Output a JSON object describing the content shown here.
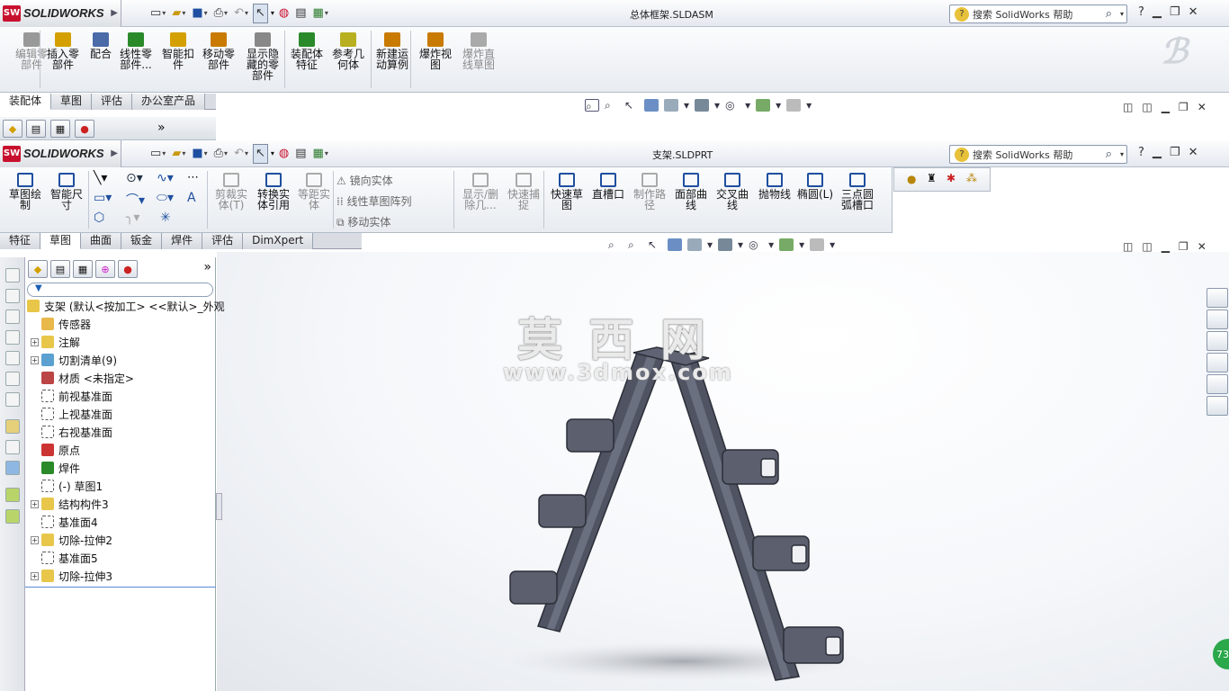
{
  "app": {
    "brand": "SOLIDWORKS",
    "logo_mark": "SW"
  },
  "assembly_window": {
    "title": "总体框架.SLDASM",
    "search_placeholder": "搜索 SolidWorks 帮助",
    "help_label": "?",
    "ribbon_buttons": [
      {
        "label": "编辑零\n部件",
        "icon": "edit-component-icon",
        "disabled": true
      },
      {
        "label": "插入零\n部件",
        "icon": "insert-component-icon"
      },
      {
        "label": "配合",
        "icon": "mate-icon"
      },
      {
        "label": "线性零\n部件...",
        "icon": "linear-pattern-icon"
      },
      {
        "label": "智能扣\n件",
        "icon": "smart-fastener-icon"
      },
      {
        "label": "移动零\n部件",
        "icon": "move-component-icon"
      },
      {
        "label": "显示隐\n藏的零\n部件",
        "icon": "show-hidden-icon"
      },
      {
        "label": "装配体\n特征",
        "icon": "assembly-feature-icon"
      },
      {
        "label": "参考几\n何体",
        "icon": "reference-geometry-icon"
      },
      {
        "label": "新建运\n动算例",
        "icon": "motion-study-icon"
      },
      {
        "label": "爆炸视\n图",
        "icon": "exploded-view-icon"
      },
      {
        "label": "爆炸直\n线草图",
        "icon": "explode-line-icon",
        "disabled": true
      }
    ],
    "tabs": [
      "装配体",
      "草图",
      "评估",
      "办公室产品"
    ],
    "active_tab": 0,
    "more_label": "»"
  },
  "part_window": {
    "title": "支架.SLDPRT",
    "search_placeholder": "搜索 SolidWorks 帮助",
    "help_label": "?",
    "ribbon_buttons": [
      {
        "label": "草图绘\n制",
        "icon": "sketch-icon"
      },
      {
        "label": "智能尺\n寸",
        "icon": "smart-dimension-icon"
      },
      {
        "label": "剪裁实\n体(T)",
        "icon": "trim-icon",
        "disabled": true
      },
      {
        "label": "转换实\n体引用",
        "icon": "convert-entities-icon"
      },
      {
        "label": "等距实\n体",
        "icon": "offset-entities-icon",
        "disabled": true
      },
      {
        "label": "显示/删\n除几...",
        "icon": "display-relations-icon",
        "disabled": true
      },
      {
        "label": "快速捕\n捉",
        "icon": "quick-snaps-icon",
        "disabled": true
      },
      {
        "label": "快速草\n图",
        "icon": "rapid-sketch-icon"
      },
      {
        "label": "直槽口",
        "icon": "straight-slot-icon"
      },
      {
        "label": "制作路\n径",
        "icon": "make-path-icon",
        "disabled": true
      },
      {
        "label": "面部曲\n线",
        "icon": "face-curves-icon"
      },
      {
        "label": "交叉曲\n线",
        "icon": "intersection-curve-icon"
      },
      {
        "label": "抛物线",
        "icon": "parabola-icon"
      },
      {
        "label": "椭圆(L)",
        "icon": "ellipse-icon"
      },
      {
        "label": "三点圆\n弧槽口",
        "icon": "arc-slot-icon"
      }
    ],
    "small_items": [
      "镜向实体",
      "线性草图阵列",
      "移动实体"
    ],
    "tabs": [
      "特征",
      "草图",
      "曲面",
      "钣金",
      "焊件",
      "评估",
      "DimXpert"
    ],
    "active_tab": 1
  },
  "feature_tree": {
    "root": "支架  (默认<按加工> <<默认>_外观",
    "items": [
      {
        "label": "传感器",
        "expandable": false,
        "icon": "sensor-icon"
      },
      {
        "label": "注解",
        "expandable": true,
        "icon": "annotation-icon"
      },
      {
        "label": "切割清单(9)",
        "expandable": true,
        "icon": "cut-list-icon"
      },
      {
        "label": "材质 <未指定>",
        "expandable": false,
        "icon": "material-icon"
      },
      {
        "label": "前视基准面",
        "expandable": false,
        "icon": "plane-icon"
      },
      {
        "label": "上视基准面",
        "expandable": false,
        "icon": "plane-icon"
      },
      {
        "label": "右视基准面",
        "expandable": false,
        "icon": "plane-icon"
      },
      {
        "label": "原点",
        "expandable": false,
        "icon": "origin-icon"
      },
      {
        "label": "焊件",
        "expandable": false,
        "icon": "weldment-icon"
      },
      {
        "label": "(-) 草图1",
        "expandable": false,
        "icon": "sketch-icon"
      },
      {
        "label": "结构构件3",
        "expandable": true,
        "icon": "structural-member-icon"
      },
      {
        "label": "基准面4",
        "expandable": false,
        "icon": "plane-icon"
      },
      {
        "label": "切除-拉伸2",
        "expandable": true,
        "icon": "cut-extrude-icon"
      },
      {
        "label": "基准面5",
        "expandable": false,
        "icon": "plane-icon"
      },
      {
        "label": "切除-拉伸3",
        "expandable": true,
        "icon": "cut-extrude-icon"
      }
    ]
  },
  "watermark": {
    "title": "莫 西 网",
    "url": "www.3dmox.com"
  },
  "badge": {
    "value": "73"
  },
  "colors": {
    "model": "#5b5f6e",
    "accent_red": "#c8102e",
    "toolbar_bg": "#e8ecf1"
  }
}
